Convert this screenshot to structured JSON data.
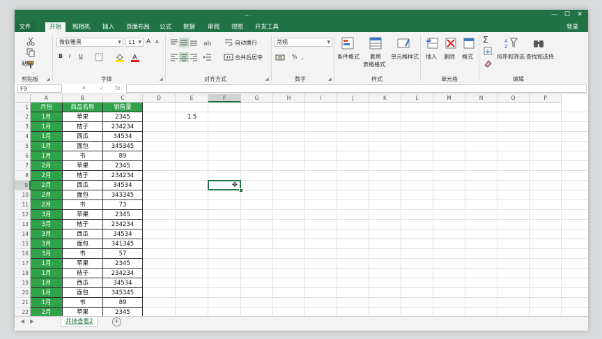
{
  "window": {
    "title": "…",
    "login": "登录"
  },
  "tabs": [
    {
      "label": "文件"
    },
    {
      "label": "开始"
    },
    {
      "label": "照相机"
    },
    {
      "label": "插入"
    },
    {
      "label": "页面布局"
    },
    {
      "label": "公式"
    },
    {
      "label": "数据"
    },
    {
      "label": "审阅"
    },
    {
      "label": "视图"
    },
    {
      "label": "开发工具"
    }
  ],
  "ribbon": {
    "clipboard": {
      "paste_label": "粘贴",
      "group_label": "剪贴板"
    },
    "font": {
      "font_name": "微软雅黑",
      "font_size": "11",
      "bold": "B",
      "italic": "I",
      "underline": "U",
      "grow": "A",
      "shrink": "A",
      "group_label": "字体"
    },
    "alignment": {
      "wrap_label": "自动换行",
      "merge_label": "合并后居中",
      "group_label": "对齐方式"
    },
    "number": {
      "format_value": "常规",
      "percent": "%",
      "comma": ",",
      "group_label": "数字"
    },
    "styles": {
      "conditional": "条件格式",
      "table_format": "套用",
      "table_format2": "表格格式",
      "cell_styles": "单元格样式",
      "group_label": "样式"
    },
    "cells": {
      "insert": "插入",
      "delete": "删除",
      "format": "格式",
      "group_label": "单元格"
    },
    "editing": {
      "sort_filter": "排序和筛选",
      "find_select": "查找和选择",
      "sum": "Σ",
      "group_label": "编辑"
    }
  },
  "formula_bar": {
    "name_box": "F9",
    "cancel": "✕",
    "enter": "✓",
    "fx": "fx",
    "value": ""
  },
  "columns": [
    "A",
    "B",
    "C",
    "D",
    "E",
    "F",
    "G",
    "H",
    "I",
    "J",
    "K",
    "L",
    "M",
    "N",
    "O",
    "P"
  ],
  "selected_column": "F",
  "row_numbers": [
    "1",
    "2",
    "3",
    "4",
    "5",
    "6",
    "7",
    "8",
    "9",
    "10",
    "11",
    "12",
    "13",
    "14",
    "15",
    "16",
    "17",
    "18",
    "19",
    "20",
    "21",
    "22"
  ],
  "selected_row": "9",
  "table": {
    "headers": [
      "月份",
      "商品名称",
      "销售量"
    ],
    "rows": [
      [
        "1月",
        "苹果",
        "2345"
      ],
      [
        "1月",
        "桔子",
        "234234"
      ],
      [
        "1月",
        "西瓜",
        "34534"
      ],
      [
        "1月",
        "面包",
        "345345"
      ],
      [
        "1月",
        "书",
        "89"
      ],
      [
        "2月",
        "苹果",
        "2345"
      ],
      [
        "2月",
        "桔子",
        "234234"
      ],
      [
        "2月",
        "西瓜",
        "34534"
      ],
      [
        "2月",
        "面包",
        "343345"
      ],
      [
        "2月",
        "书",
        "73"
      ],
      [
        "3月",
        "苹果",
        "2345"
      ],
      [
        "3月",
        "桔子",
        "234234"
      ],
      [
        "3月",
        "西瓜",
        "34534"
      ],
      [
        "3月",
        "面包",
        "341345"
      ],
      [
        "3月",
        "书",
        "57"
      ],
      [
        "1月",
        "苹果",
        "2345"
      ],
      [
        "1月",
        "桔子",
        "234234"
      ],
      [
        "1月",
        "西瓜",
        "34534"
      ],
      [
        "1月",
        "面包",
        "345345"
      ],
      [
        "1月",
        "书",
        "89"
      ],
      [
        "2月",
        "苹果",
        "2345"
      ]
    ]
  },
  "e2_value": "1.5",
  "sheet": {
    "tab_label": "井排查看2",
    "add_symbol": "+"
  },
  "colors": {
    "accent": "#217346",
    "table_green": "#2fa24a"
  }
}
